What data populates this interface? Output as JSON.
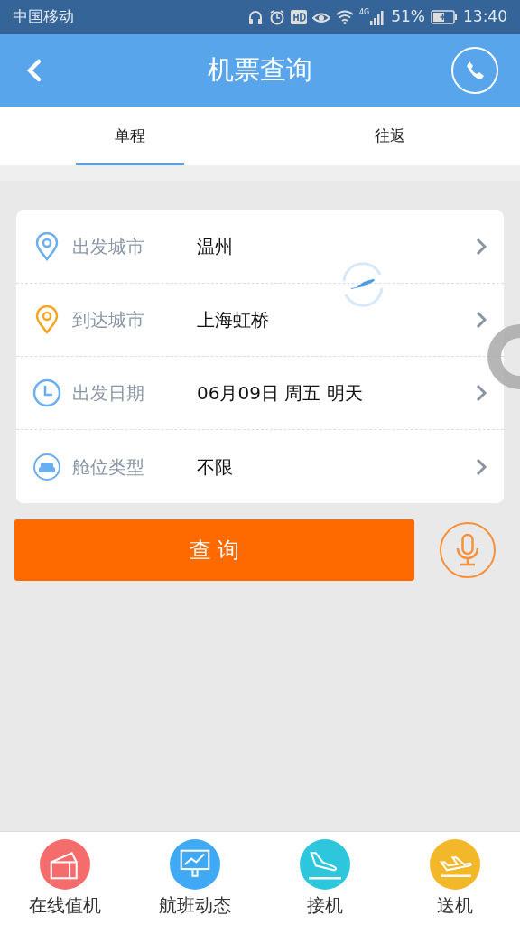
{
  "status_bar": {
    "carrier": "中国移动",
    "network": "4G",
    "battery": "51%",
    "time": "13:40"
  },
  "header": {
    "title": "机票查询"
  },
  "tabs": [
    {
      "label": "单程",
      "selected": true
    },
    {
      "label": "往返",
      "selected": false
    }
  ],
  "form": {
    "rows": [
      {
        "kind": "pin",
        "color": "#6aaef0",
        "label": "出发城市",
        "value": "温州"
      },
      {
        "kind": "pin",
        "color": "#f5a623",
        "label": "到达城市",
        "value": "上海虹桥"
      },
      {
        "kind": "clock",
        "color": "#6aaef0",
        "label": "出发日期",
        "value": "06月09日 周五 明天"
      },
      {
        "kind": "seat",
        "color": "#6aaef0",
        "label": "舱位类型",
        "value": "不限"
      }
    ]
  },
  "search_button": "查 询",
  "bottom_nav": [
    {
      "kind": "ticket",
      "color": "#f56c6c",
      "label": "在线值机"
    },
    {
      "kind": "board",
      "color": "#3fa9f5",
      "label": "航班动态"
    },
    {
      "kind": "arrive",
      "color": "#2ec6dc",
      "label": "接机"
    },
    {
      "kind": "depart",
      "color": "#f3b72a",
      "label": "送机"
    }
  ]
}
